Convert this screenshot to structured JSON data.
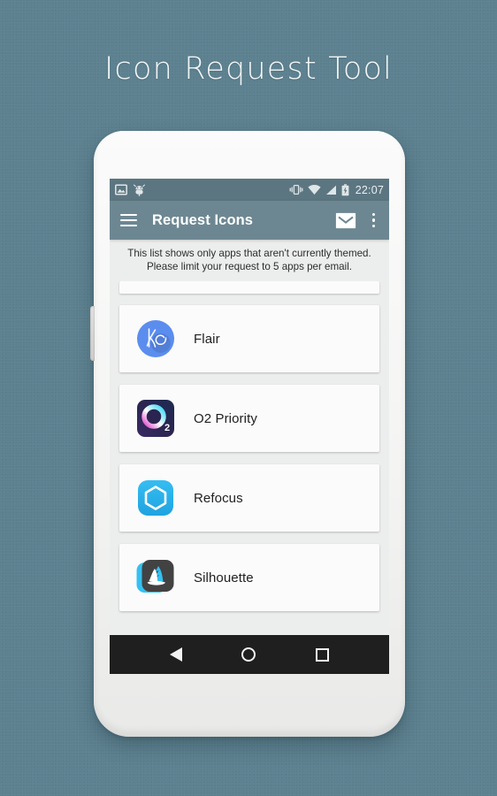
{
  "page": {
    "title": "Icon Request Tool",
    "background_color": "#5d8190"
  },
  "phone": {
    "statusbar": {
      "background_color": "#5c7681",
      "left_icons": [
        "image-icon",
        "android-debug-icon"
      ],
      "right_icons": [
        "vibrate-icon",
        "wifi-icon",
        "signal-icon",
        "battery-charging-icon"
      ],
      "clock": "22:07"
    },
    "appbar": {
      "background_color": "#6d8792",
      "menu_icon": "hamburger-menu-icon",
      "title": "Request Icons",
      "mail_icon": "envelope-icon",
      "overflow_icon": "overflow-menu-icon"
    },
    "info_banner": {
      "line1": "This list shows only apps that aren't currently themed.",
      "line2": "Please limit your request to 5 apps per email."
    },
    "app_list": [
      {
        "name": "Flair",
        "icon": "flair-app-icon",
        "icon_shape": "circle",
        "icon_color": "#5b8def"
      },
      {
        "name": "O2 Priority",
        "icon": "o2-priority-app-icon",
        "icon_shape": "rounded-square",
        "icon_color": "#2b2350"
      },
      {
        "name": "Refocus",
        "icon": "refocus-app-icon",
        "icon_shape": "rounded-square",
        "icon_color": "#2ab4ec"
      },
      {
        "name": "Silhouette",
        "icon": "silhouette-app-icon",
        "icon_shape": "rounded-square",
        "icon_color": "#424242"
      }
    ],
    "navbar": {
      "background_color": "#1f1f1f",
      "buttons": [
        "back-button",
        "home-button",
        "recents-button"
      ]
    }
  }
}
